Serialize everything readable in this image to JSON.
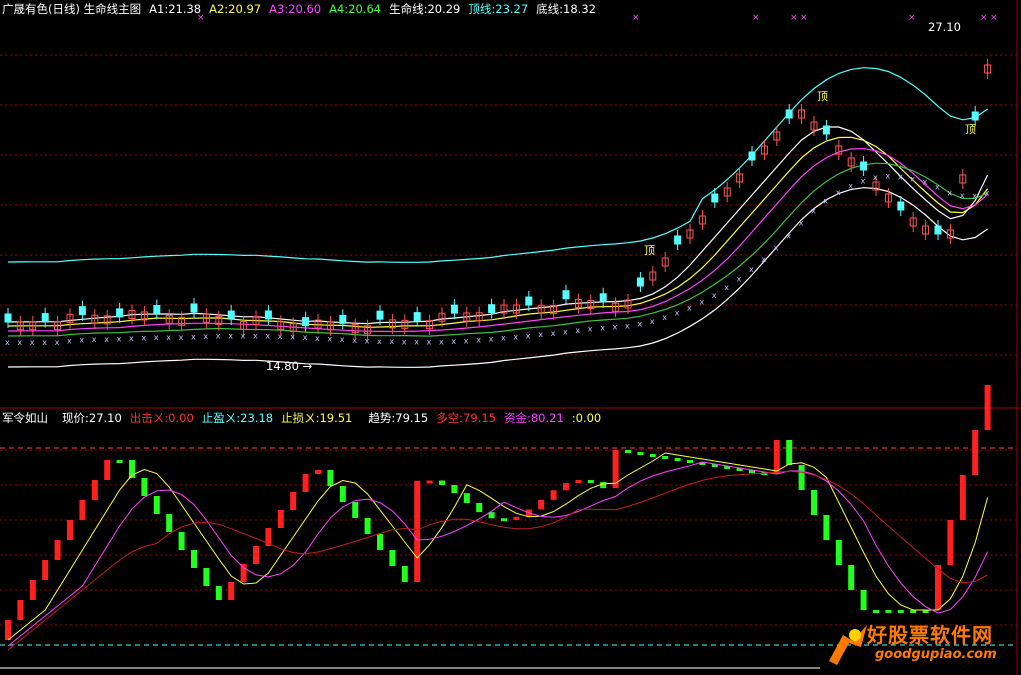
{
  "top_header": {
    "title": "广晟有色(日线) 生命线主图",
    "a1": "A1:21.38",
    "a2": "A2:20.97",
    "a3": "A3:20.60",
    "a4": "A4:20.64",
    "life": "生命线:20.29",
    "top": "顶线:23.27",
    "bottom": "底线:18.32"
  },
  "bottom_header": {
    "title": "军令如山",
    "price": "现价:27.10",
    "attack": "出击ㄨ:0.00",
    "take_profit": "止盈ㄨ:23.18",
    "stop_loss": "止损ㄨ:19.51",
    "trend": "趋势:79.15",
    "long_short": "多空:79.15",
    "fund": "资金:80.21",
    "extra": ":0.00"
  },
  "annotations": {
    "high_price": "27.10",
    "low_price": "14.80",
    "top_mark": "顶"
  },
  "watermark": {
    "cn": "好股票软件网",
    "en": "goodgupiao.com"
  },
  "colors": {
    "background": "#000000",
    "up_candle": "#ff5555",
    "down_candle": "#54ffff",
    "white_line": "#ffffff",
    "magenta_line": "#ff40ff",
    "cyan_line": "#54ffff",
    "green_line": "#40c040",
    "yellow_line": "#ffff40",
    "red_bar": "#ff2020",
    "green_bar": "#20ff20",
    "grid": "#a00000"
  }
}
